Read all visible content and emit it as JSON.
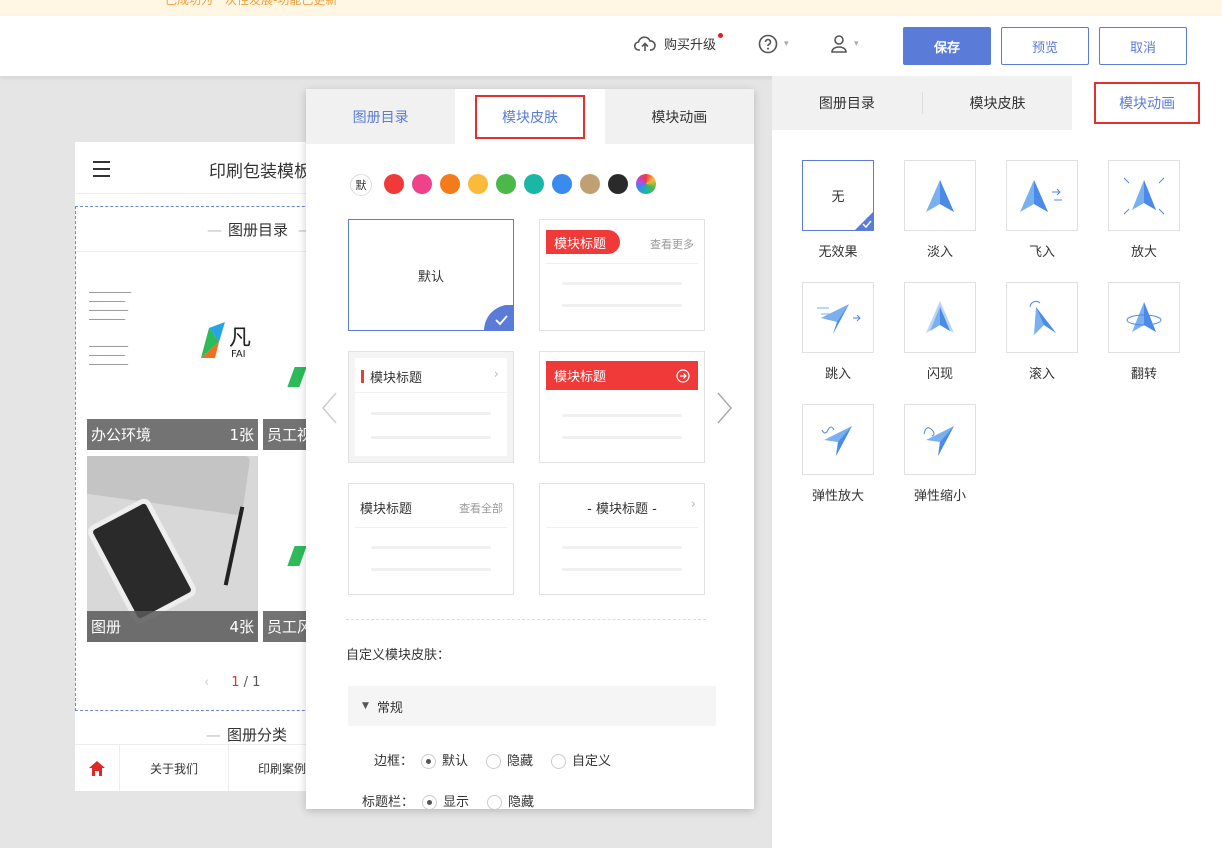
{
  "banner": {
    "text": "已成功为一次性发展-功能已更新"
  },
  "header": {
    "upgrade_label": "购买升级",
    "help_icon": "question-circle-icon",
    "user_icon": "user-icon",
    "save_label": "保存",
    "preview_label": "预览",
    "cancel_label": "取消",
    "accent": "#5b7bd8"
  },
  "preview": {
    "title": "印刷包装模板",
    "section_title": "图册目录",
    "albums": [
      {
        "name": "办公环境",
        "count": "1张"
      },
      {
        "name": "员工视",
        "count": ""
      },
      {
        "name": "图册",
        "count": "4张"
      },
      {
        "name": "员工风",
        "count": ""
      }
    ],
    "pagination": {
      "current": "1",
      "separator": "/",
      "total": "1"
    },
    "section2_title": "图册分类",
    "bottom_nav": [
      "关于我们",
      "印刷案例"
    ]
  },
  "skin_panel": {
    "tabs": [
      "图册目录",
      "模块皮肤",
      "模块动画"
    ],
    "default_swatch_label": "默",
    "swatch_colors": [
      "#f03a3a",
      "#f0428a",
      "#f57a1a",
      "#fbbb3a",
      "#4ab84a",
      "#1ab6a6",
      "#3a8af0",
      "#c0a072",
      "#2a2a2a"
    ],
    "cards": [
      {
        "title": "默认",
        "more": ""
      },
      {
        "title": "模块标题",
        "more": "查看更多"
      },
      {
        "title": "模块标题",
        "more": ""
      },
      {
        "title": "模块标题",
        "more": ""
      },
      {
        "title": "模块标题",
        "more": "查看全部"
      },
      {
        "title": "- 模块标题 -",
        "more": ""
      }
    ],
    "custom_label": "自定义模块皮肤：",
    "section_general": "常规",
    "border_label": "边框：",
    "border_options": [
      "默认",
      "隐藏",
      "自定义"
    ],
    "titlebar_label": "标题栏：",
    "titlebar_options": [
      "显示",
      "隐藏"
    ]
  },
  "anim_panel": {
    "tabs": [
      "图册目录",
      "模块皮肤",
      "模块动画"
    ],
    "none_text": "无",
    "items": [
      "无效果",
      "淡入",
      "飞入",
      "放大",
      "跳入",
      "闪现",
      "滚入",
      "翻转",
      "弹性放大",
      "弹性缩小"
    ]
  }
}
